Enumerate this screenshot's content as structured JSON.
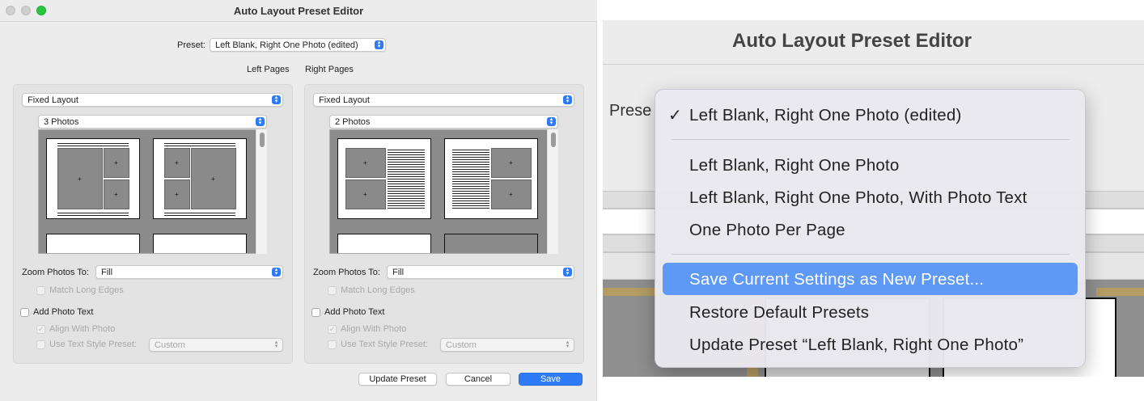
{
  "window": {
    "title": "Auto Layout Preset Editor"
  },
  "preset": {
    "label": "Preset:",
    "value": "Left Blank, Right One Photo (edited)"
  },
  "column_headers": {
    "left": "Left Pages",
    "right": "Right Pages"
  },
  "left_panel": {
    "layout": "Fixed Layout",
    "photos": "3 Photos",
    "zoom_label": "Zoom Photos To:",
    "zoom_value": "Fill",
    "match_long_edges": "Match Long Edges",
    "add_photo_text": "Add Photo Text",
    "align_with_photo": "Align With Photo",
    "use_text_style": "Use Text Style Preset:",
    "text_style_value": "Custom"
  },
  "right_panel": {
    "layout": "Fixed Layout",
    "photos": "2 Photos",
    "zoom_label": "Zoom Photos To:",
    "zoom_value": "Fill",
    "match_long_edges": "Match Long Edges",
    "add_photo_text": "Add Photo Text",
    "align_with_photo": "Align With Photo",
    "use_text_style": "Use Text Style Preset:",
    "text_style_value": "Custom"
  },
  "buttons": {
    "update": "Update Preset",
    "cancel": "Cancel",
    "save": "Save"
  },
  "zoom": {
    "title": "Auto Layout Preset Editor",
    "preset_label_partial": "Prese",
    "menu": {
      "checked": "Left Blank, Right One Photo (edited)",
      "items": [
        "Left Blank, Right One Photo",
        "Left Blank, Right One Photo, With Photo Text",
        "One Photo Per Page"
      ],
      "actions": [
        "Save Current Settings as New Preset...",
        "Restore Default Presets",
        "Update Preset “Left Blank, Right One Photo”"
      ]
    }
  },
  "colors": {
    "accent": "#2f7bf6",
    "highlight": "#5e99f5",
    "window_bg": "#ececec"
  }
}
